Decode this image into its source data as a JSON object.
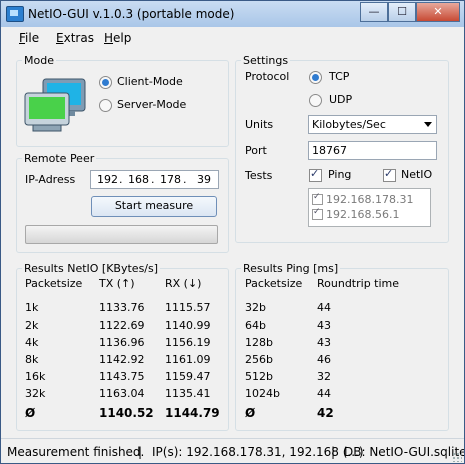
{
  "window": {
    "title": "NetIO-GUI v.1.0.3 (portable mode)",
    "btn_min": "—",
    "btn_max": "☐",
    "btn_close": "✕"
  },
  "menu": [
    {
      "accel": "F",
      "rest": "ile"
    },
    {
      "accel": "E",
      "rest": "xtras"
    },
    {
      "accel": "H",
      "rest": "elp"
    }
  ],
  "mode": {
    "label": "Mode",
    "client": "Client-Mode",
    "server": "Server-Mode",
    "selected": "client"
  },
  "remote_peer": {
    "label": "Remote Peer",
    "ip_label": "IP-Adress",
    "ip": [
      "192",
      "168",
      "178",
      "39"
    ],
    "start_button": "Start measure",
    "progress": 0
  },
  "settings": {
    "label": "Settings",
    "protocol_label": "Protocol",
    "tcp": "TCP",
    "udp": "UDP",
    "protocol_selected": "tcp",
    "units_label": "Units",
    "units_value": "Kilobytes/Sec",
    "port_label": "Port",
    "port_value": "18767",
    "tests_label": "Tests",
    "test_ping": "Ping",
    "test_netio": "NetIO",
    "hosts": [
      "192.168.178.31",
      "192.168.56.1"
    ]
  },
  "results_netio": {
    "label": "Results NetIO [KBytes/s]",
    "headers": [
      "Packetsize",
      "TX (↑)",
      "RX (↓)"
    ],
    "rows": [
      {
        "size": "1k",
        "tx": "1133.76",
        "rx": "1115.57"
      },
      {
        "size": "2k",
        "tx": "1122.69",
        "rx": "1140.99"
      },
      {
        "size": "4k",
        "tx": "1136.96",
        "rx": "1156.19"
      },
      {
        "size": "8k",
        "tx": "1142.92",
        "rx": "1161.09"
      },
      {
        "size": "16k",
        "tx": "1143.75",
        "rx": "1159.47"
      },
      {
        "size": "32k",
        "tx": "1163.04",
        "rx": "1135.41"
      }
    ],
    "avg": {
      "size": "Ø",
      "tx": "1140.52",
      "rx": "1144.79"
    }
  },
  "results_ping": {
    "label": "Results Ping [ms]",
    "headers": [
      "Packetsize",
      "Roundtrip time"
    ],
    "rows": [
      {
        "size": "32b",
        "rtt": "44"
      },
      {
        "size": "64b",
        "rtt": "43"
      },
      {
        "size": "128b",
        "rtt": "43"
      },
      {
        "size": "256b",
        "rtt": "46"
      },
      {
        "size": "512b",
        "rtt": "32"
      },
      {
        "size": "1024b",
        "rtt": "44"
      }
    ],
    "avg": {
      "size": "Ø",
      "rtt": "42"
    }
  },
  "status": {
    "message": "Measurement finished.",
    "ips": "IP(s): 192.168.178.31, 192.168 (...)",
    "db": "DB: NetIO-GUI.sqlite",
    "sep": "|"
  }
}
